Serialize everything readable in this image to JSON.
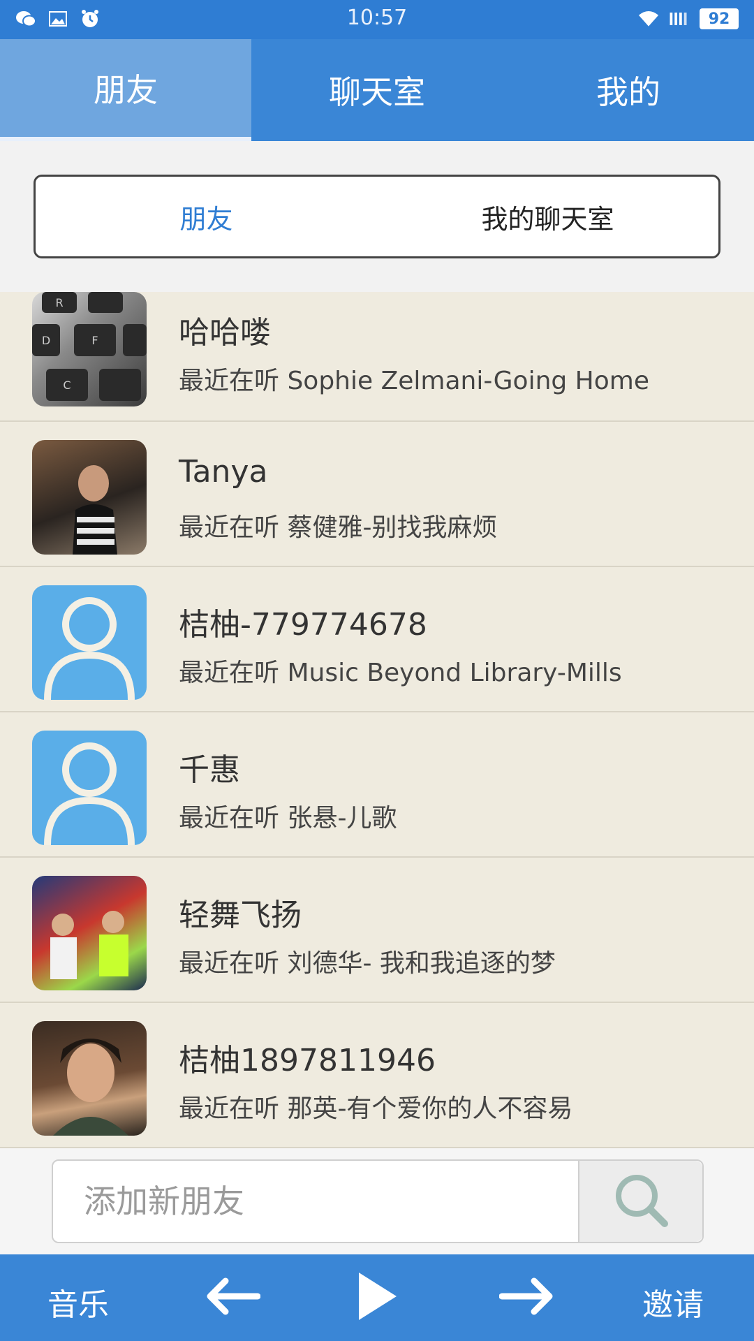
{
  "status_bar": {
    "time": "10:57",
    "battery": "92",
    "left_icons": [
      "wechat-icon",
      "image-icon",
      "alarm-icon"
    ],
    "right_icons": [
      "wifi-icon",
      "signal-icon",
      "battery-icon"
    ]
  },
  "top_tabs": [
    {
      "label": "朋友",
      "active": true
    },
    {
      "label": "聊天室",
      "active": false
    },
    {
      "label": "我的",
      "active": false
    }
  ],
  "segment": [
    {
      "label": "朋友",
      "active": true
    },
    {
      "label": "我的聊天室",
      "active": false
    }
  ],
  "friends": [
    {
      "name": "哈哈喽",
      "status": "最近在听 Sophie Zelmani-Going Home",
      "avatar": "photo-keys"
    },
    {
      "name": "Tanya",
      "status": "最近在听 蔡健雅-别找我麻烦",
      "avatar": "photo-street"
    },
    {
      "name": "桔柚-779774678",
      "status": "最近在听 Music Beyond Library-Mills",
      "avatar": "default"
    },
    {
      "name": "千惠",
      "status": "最近在听 张悬-儿歌",
      "avatar": "default"
    },
    {
      "name": "轻舞飞扬",
      "status": "最近在听 刘德华- 我和我追逐的梦",
      "avatar": "photo-stage"
    },
    {
      "name": "桔柚1897811946",
      "status": "最近在听 那英-有个爱你的人不容易",
      "avatar": "photo-portrait"
    }
  ],
  "search": {
    "placeholder": "添加新朋友",
    "value": ""
  },
  "bottom_bar": {
    "music_label": "音乐",
    "invite_label": "邀请"
  },
  "colors": {
    "primary": "#3a86d6",
    "active_tab": "#6fa6df",
    "list_bg": "#efebdf",
    "default_avatar": "#5aaee8"
  }
}
